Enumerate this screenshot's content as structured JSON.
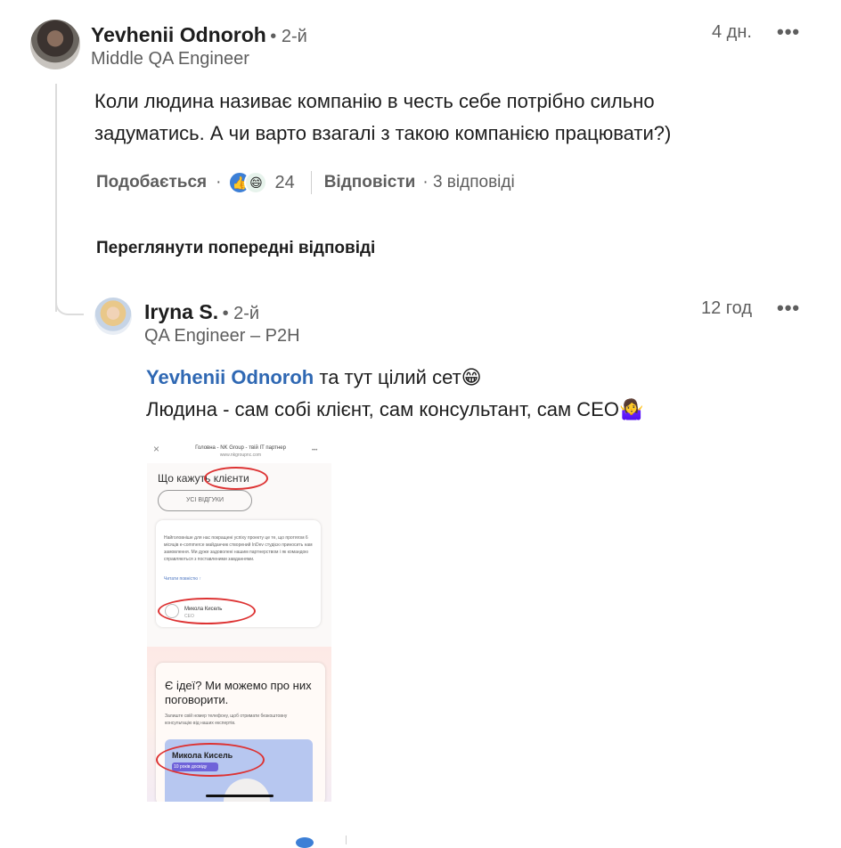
{
  "comment1": {
    "author": "Yevhenii Odnoroh",
    "degree": "• 2-й",
    "title": "Middle QA Engineer",
    "time": "4 дн.",
    "more": "•••",
    "text_line1": "Коли людина називає компанію в честь себе потрібно сильно",
    "text_line2": "задуматись. А чи варто взагалі з такою компанією працювати?)",
    "like_label": "Подобається",
    "dot": "·",
    "reaction_count": "24",
    "reply_label": "Відповісти",
    "replies_count": "· 3 відповіді"
  },
  "view_previous": "Переглянути попередні відповіді",
  "reply1": {
    "author": "Iryna S.",
    "degree": "• 2-й",
    "title": "QA Engineer – P2H",
    "time": "12 год",
    "more": "•••",
    "mention": "Yevhenii Odnoroh",
    "text_line1_rest": " та тут цілий сет😁",
    "text_line2": "Людина - сам собі клієнт, сам консультант, сам CEO🤷‍♀️"
  },
  "screenshot": {
    "close": "×",
    "header_title": "Головна - NK Group - твій IT партнер",
    "header_url": "www.nkgroupnc.com",
    "header_more": "•••",
    "section_title": "Що кажуть клієнти",
    "all_reviews": "УСІ ВІДГУКИ",
    "review_text": "Найголовніше для нас покращені успіху проекту це те, що протягом 6 місяців e-commerce майданчик створений InDev студією приносить нам замовлення. Ми дуже задоволені нашим партнерством і як командою справляються з поставленими завданнями.",
    "read_more": "Читати повністю ↑",
    "reviewer_name": "Микола Кисель",
    "reviewer_role": "CEO",
    "cta_title": "Є ідеї? Ми можемо про них поговорити.",
    "cta_text": "Залиште свій номер телефону, щоб отримати безкоштовну консультацію від наших експертів.",
    "expert_name": "Микола Кисель",
    "expert_exp": "10 років досвіду"
  }
}
